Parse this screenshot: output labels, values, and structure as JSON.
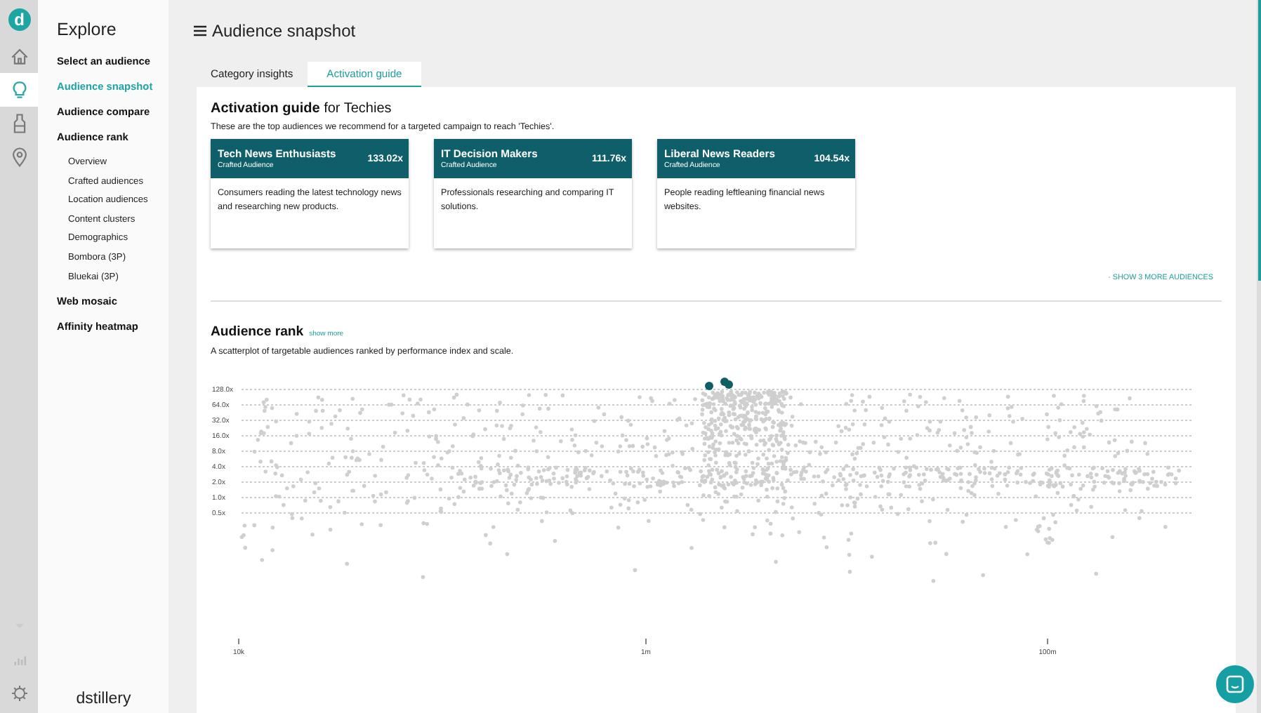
{
  "rail": {
    "logo": "d",
    "items": [
      {
        "kind": "home",
        "selected": false
      },
      {
        "kind": "bulb",
        "selected": true
      },
      {
        "kind": "jar",
        "selected": false
      },
      {
        "kind": "pin",
        "selected": false
      }
    ],
    "bottom": [
      {
        "kind": "caret"
      },
      {
        "kind": "bars"
      },
      {
        "kind": "gear"
      }
    ]
  },
  "sidebar": {
    "title": "Explore",
    "items": [
      {
        "label": "Select an audience",
        "selected": false
      },
      {
        "label": "Audience snapshot",
        "selected": true
      },
      {
        "label": "Audience compare",
        "selected": false
      },
      {
        "label": "Audience rank",
        "selected": false,
        "children": [
          {
            "label": "Overview",
            "selected": false
          },
          {
            "label": "Crafted audiences",
            "selected": false
          },
          {
            "label": "Location audiences",
            "selected": false
          },
          {
            "label": "Content clusters",
            "selected": false
          },
          {
            "label": "Demographics",
            "selected": false
          },
          {
            "label": "Bombora (3P)",
            "selected": false
          },
          {
            "label": "Bluekai (3P)",
            "selected": false
          }
        ]
      },
      {
        "label": "Web mosaic",
        "selected": false
      },
      {
        "label": "Affinity heatmap",
        "selected": false
      }
    ],
    "brand": "dstillery"
  },
  "header": {
    "title": "Audience snapshot"
  },
  "tabs": [
    {
      "label": "Category insights",
      "selected": false
    },
    {
      "label": "Activation guide",
      "selected": true
    }
  ],
  "activation": {
    "title": "Activation guide",
    "subject": "for Techies",
    "description": "These are the top audiences we recommend for a targeted campaign to reach 'Techies'.",
    "cards": [
      {
        "title": "Tech News Enthusiasts",
        "type": "Crafted Audience",
        "score": "133.02x",
        "description": "Consumers reading the latest technology news and researching new products."
      },
      {
        "title": "IT Decision Makers",
        "type": "Crafted Audience",
        "score": "111.76x",
        "description": "Professionals researching and comparing IT solutions."
      },
      {
        "title": "Liberal News Readers",
        "type": "Crafted Audience",
        "score": "104.54x",
        "description": "People reading leftleaning financial news websites."
      }
    ],
    "more_link": "· SHOW 3 MORE AUDIENCES"
  },
  "rank": {
    "title": "Audience rank",
    "link": "show more",
    "description": "A scatterplot of targetable audiences ranked by performance index and scale.",
    "y_ticks": [
      "128.0x",
      "64.0x",
      "32.0x",
      "16.0x",
      "8.0x",
      "4.0x",
      "2.0x",
      "1.0x",
      "0.5x"
    ],
    "x_ticks": [
      "10k",
      "1m",
      "100m"
    ]
  }
}
